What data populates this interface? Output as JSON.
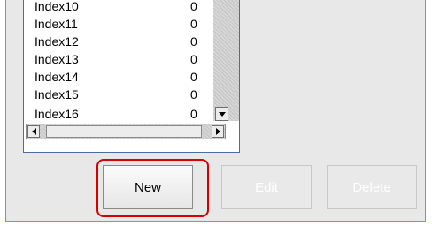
{
  "list": {
    "rows": [
      {
        "name": "Index10",
        "value": "0"
      },
      {
        "name": "Index11",
        "value": "0"
      },
      {
        "name": "Index12",
        "value": "0"
      },
      {
        "name": "Index13",
        "value": "0"
      },
      {
        "name": "Index14",
        "value": "0"
      },
      {
        "name": "Index15",
        "value": "0"
      },
      {
        "name": "Index16",
        "value": "0"
      }
    ]
  },
  "buttons": {
    "new_label": "New",
    "edit_label": "Edit",
    "delete_label": "Delete"
  },
  "colors": {
    "highlight": "#d80000",
    "panel_border": "#7a96c0"
  }
}
